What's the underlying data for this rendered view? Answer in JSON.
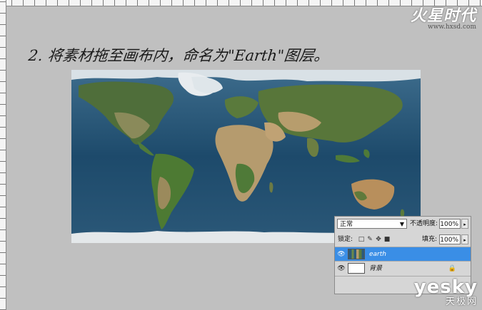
{
  "watermark_top": {
    "title": "火星时代",
    "url": "www.hxsd.com"
  },
  "instruction": "2. 将素材拖至画布内，命名为\"Earth\"图层。",
  "layers_panel": {
    "blend_mode": "正常",
    "opacity_label": "不透明度:",
    "opacity_value": "100%",
    "lock_label": "锁定:",
    "lock_icons": [
      "lock-transparent-icon",
      "lock-brush-icon",
      "lock-move-icon",
      "lock-all-icon"
    ],
    "fill_label": "填充:",
    "fill_value": "100%",
    "layers": [
      {
        "name": "earth",
        "selected": true,
        "visible": true
      },
      {
        "name": "背景",
        "selected": false,
        "visible": true,
        "locked": true
      }
    ]
  },
  "watermark_bottom": {
    "brand": "yesky",
    "name": "天极网"
  },
  "colors": {
    "background": "#c0c0c0",
    "selection": "#3a8ee6",
    "ocean": "#1f4a6a"
  }
}
